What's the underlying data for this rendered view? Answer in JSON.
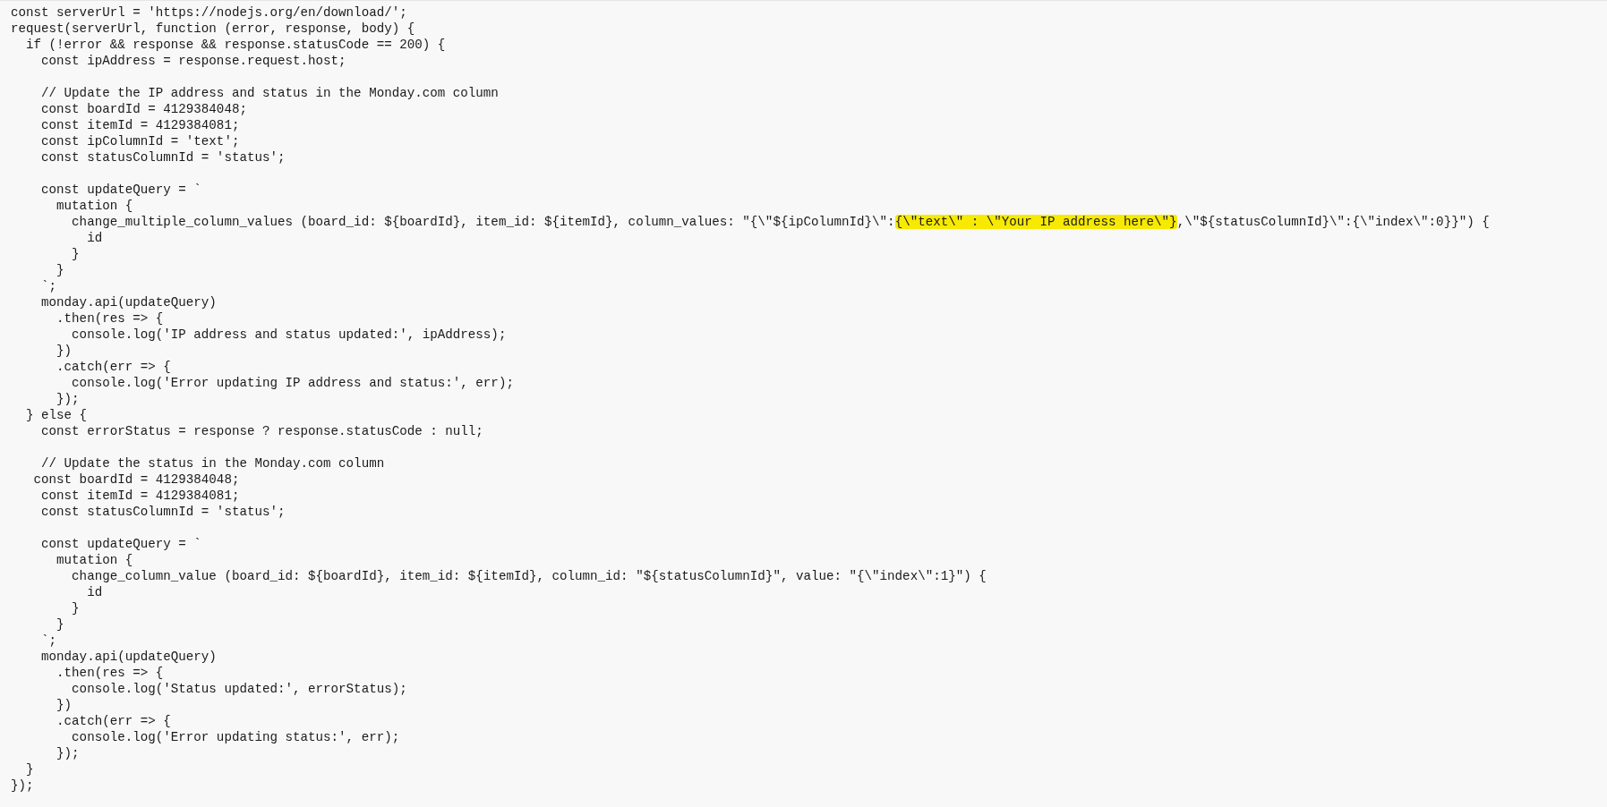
{
  "code_lines": [
    {
      "kind": "code",
      "text": "const serverUrl = 'https://nodejs.org/en/download/';"
    },
    {
      "kind": "code",
      "text": "request(serverUrl, function (error, response, body) {"
    },
    {
      "kind": "code",
      "text": "  if (!error && response && response.statusCode == 200) {"
    },
    {
      "kind": "code",
      "text": "    const ipAddress = response.request.host;"
    },
    {
      "kind": "blank"
    },
    {
      "kind": "code",
      "text": "    // Update the IP address and status in the Monday.com column"
    },
    {
      "kind": "code",
      "text": "    const boardId = 4129384048;"
    },
    {
      "kind": "code",
      "text": "    const itemId = 4129384081;"
    },
    {
      "kind": "code",
      "text": "    const ipColumnId = 'text';"
    },
    {
      "kind": "code",
      "text": "    const statusColumnId = 'status';"
    },
    {
      "kind": "blank"
    },
    {
      "kind": "code",
      "text": "    const updateQuery = `"
    },
    {
      "kind": "code",
      "text": "      mutation {"
    },
    {
      "kind": "segmented",
      "segments": [
        {
          "text": "        change_multiple_column_values (board_id: ${boardId}, item_id: ${itemId}, column_values: \"{\\\"${ipColumnId}\\\":",
          "highlighted": false
        },
        {
          "text": "{\\\"text\\\" : \\\"Your IP address here\\\"}",
          "highlighted": true
        },
        {
          "text": ",\\\"${statusColumnId}\\\":{\\\"index\\\":0}}\") {",
          "highlighted": false
        }
      ]
    },
    {
      "kind": "code",
      "text": "          id"
    },
    {
      "kind": "code",
      "text": "        }"
    },
    {
      "kind": "code",
      "text": "      }"
    },
    {
      "kind": "code",
      "text": "    `;"
    },
    {
      "kind": "code",
      "text": "    monday.api(updateQuery)"
    },
    {
      "kind": "code",
      "text": "      .then(res => {"
    },
    {
      "kind": "code",
      "text": "        console.log('IP address and status updated:', ipAddress);"
    },
    {
      "kind": "code",
      "text": "      })"
    },
    {
      "kind": "code",
      "text": "      .catch(err => {"
    },
    {
      "kind": "code",
      "text": "        console.log('Error updating IP address and status:', err);"
    },
    {
      "kind": "code",
      "text": "      });"
    },
    {
      "kind": "code",
      "text": "  } else {"
    },
    {
      "kind": "code",
      "text": "    const errorStatus = response ? response.statusCode : null;"
    },
    {
      "kind": "blank"
    },
    {
      "kind": "code",
      "text": "    // Update the status in the Monday.com column"
    },
    {
      "kind": "code",
      "text": "   const boardId = 4129384048;"
    },
    {
      "kind": "code",
      "text": "    const itemId = 4129384081;"
    },
    {
      "kind": "code",
      "text": "    const statusColumnId = 'status';"
    },
    {
      "kind": "blank"
    },
    {
      "kind": "code",
      "text": "    const updateQuery = `"
    },
    {
      "kind": "code",
      "text": "      mutation {"
    },
    {
      "kind": "code",
      "text": "        change_column_value (board_id: ${boardId}, item_id: ${itemId}, column_id: \"${statusColumnId}\", value: \"{\\\"index\\\":1}\") {"
    },
    {
      "kind": "code",
      "text": "          id"
    },
    {
      "kind": "code",
      "text": "        }"
    },
    {
      "kind": "code",
      "text": "      }"
    },
    {
      "kind": "code",
      "text": "    `;"
    },
    {
      "kind": "code",
      "text": "    monday.api(updateQuery)"
    },
    {
      "kind": "code",
      "text": "      .then(res => {"
    },
    {
      "kind": "code",
      "text": "        console.log('Status updated:', errorStatus);"
    },
    {
      "kind": "code",
      "text": "      })"
    },
    {
      "kind": "code",
      "text": "      .catch(err => {"
    },
    {
      "kind": "code",
      "text": "        console.log('Error updating status:', err);"
    },
    {
      "kind": "code",
      "text": "      });"
    },
    {
      "kind": "code",
      "text": "  }"
    },
    {
      "kind": "code",
      "text": "});"
    }
  ]
}
